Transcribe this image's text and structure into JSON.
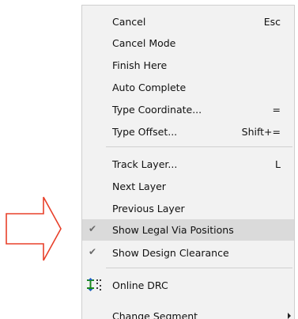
{
  "menu": {
    "group1": [
      {
        "label": "Cancel",
        "shortcut": "Esc"
      },
      {
        "label": "Cancel Mode",
        "shortcut": ""
      },
      {
        "label": "Finish Here",
        "shortcut": ""
      },
      {
        "label": "Auto Complete",
        "shortcut": ""
      },
      {
        "label": "Type Coordinate...",
        "shortcut": "="
      },
      {
        "label": "Type Offset...",
        "shortcut": "Shift+="
      }
    ],
    "group2": [
      {
        "label": "Track Layer...",
        "shortcut": "L"
      },
      {
        "label": "Next Layer",
        "shortcut": ""
      },
      {
        "label": "Previous Layer",
        "shortcut": ""
      },
      {
        "label": "Show Legal Via Positions",
        "shortcut": "",
        "checked": true,
        "highlighted": true
      },
      {
        "label": "Show Design Clearance",
        "shortcut": "",
        "checked": true
      }
    ],
    "drc": {
      "label": "Online DRC",
      "icon": "online-drc-icon"
    },
    "change_segment": {
      "label": "Change Segment",
      "has_submenu": true
    },
    "check_glyph": "✔"
  },
  "annotation": {
    "arrow_icon": "right-arrow-outline-icon",
    "color": "#e8402a"
  },
  "colors": {
    "menu_bg": "#f2f2f2",
    "highlight_bg": "#dadada",
    "separator": "#cfcfcf",
    "text": "#111111"
  }
}
